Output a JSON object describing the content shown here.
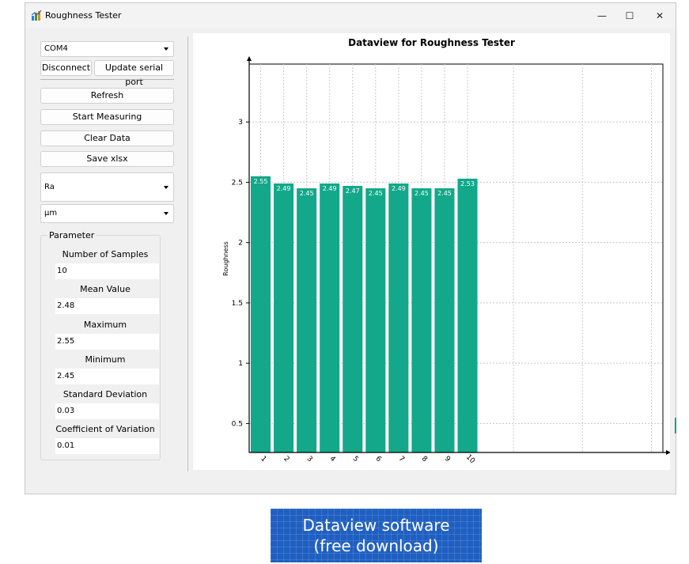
{
  "window": {
    "title": "Roughness Tester",
    "controls": {
      "minimize": "—",
      "maximize": "☐",
      "close": "✕"
    }
  },
  "sidebar": {
    "port_select": "COM4",
    "disconnect_label": "Disconnect",
    "update_port_label": "Update serial port",
    "refresh_label": "Refresh",
    "start_label": "Start Measuring",
    "clear_label": "Clear Data",
    "save_label": "Save xlsx",
    "parameter_select": "Ra",
    "unit_select": "µm"
  },
  "parameter_group": {
    "title": "Parameter",
    "items": [
      {
        "label": "Number of Samples",
        "value": "10"
      },
      {
        "label": "Mean Value",
        "value": "2.48"
      },
      {
        "label": "Maximum",
        "value": "2.55"
      },
      {
        "label": "Minimum",
        "value": "2.45"
      },
      {
        "label": "Standard Deviation",
        "value": "0.03"
      },
      {
        "label": "Coefficient of Variation",
        "value": "0.01"
      }
    ]
  },
  "chart_data": {
    "type": "bar",
    "title": "Dataview for Roughness Tester",
    "xlabel": "",
    "ylabel": "Roughness",
    "categories": [
      "1",
      "2",
      "3",
      "4",
      "5",
      "6",
      "7",
      "8",
      "9",
      "10"
    ],
    "values": [
      2.55,
      2.49,
      2.45,
      2.49,
      2.47,
      2.45,
      2.49,
      2.45,
      2.45,
      2.53
    ],
    "data_labels": [
      "2.55",
      "2.49",
      "2.45",
      "2.49",
      "2.47",
      "2.45",
      "2.49",
      "2.45",
      "2.45",
      "2.53"
    ],
    "yticks": [
      0.5,
      1,
      1.5,
      2,
      2.5,
      3
    ],
    "ytick_labels": [
      "0.5",
      "1",
      "1.5",
      "2",
      "2.5",
      "3"
    ],
    "ylim": [
      0.26,
      3.48
    ],
    "xlim": [
      0.5,
      18.5
    ],
    "grid": true,
    "color": "#13a889"
  },
  "banner": {
    "line1": "Dataview software",
    "line2": "(free download)"
  },
  "colors": {
    "bar": "#13a889",
    "banner": "#1f5fc1",
    "window_bg": "#f0f0f0"
  }
}
